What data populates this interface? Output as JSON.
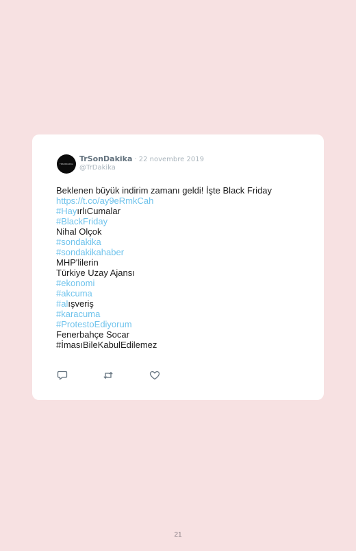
{
  "tweet": {
    "avatar_mark": "TRSONDAKIKA",
    "author_name": "TrSonDakika",
    "separator": "·",
    "date": "22 novembre 2019",
    "handle": "@TrDakika",
    "lines": [
      [
        {
          "t": "Beklenen büyük indirim zamanı geldi! İşte Black Friday",
          "link": false
        }
      ],
      [
        {
          "t": "https://t.co/ay9eRmkCah",
          "link": true
        }
      ],
      [
        {
          "t": "#Hay",
          "link": true
        },
        {
          "t": "ırlıCumalar",
          "link": false
        }
      ],
      [
        {
          "t": "#BlackFriday",
          "link": true
        }
      ],
      [
        {
          "t": "Nihal Olçok",
          "link": false
        }
      ],
      [
        {
          "t": "#sondakika",
          "link": true
        }
      ],
      [
        {
          "t": "#sondakikahaber",
          "link": true
        }
      ],
      [
        {
          "t": "MHP'lilerin",
          "link": false
        }
      ],
      [
        {
          "t": "Türkiye Uzay Ajansı",
          "link": false
        }
      ],
      [
        {
          "t": "#ekonomi",
          "link": true
        }
      ],
      [
        {
          "t": "#akcuma",
          "link": true
        }
      ],
      [
        {
          "t": "#al",
          "link": true
        },
        {
          "t": "ışveriş",
          "link": false
        }
      ],
      [
        {
          "t": "#karacuma",
          "link": true
        }
      ],
      [
        {
          "t": "#ProtestoEdiyorum",
          "link": true
        }
      ],
      [
        {
          "t": "Fenerbahçe Socar",
          "link": false
        }
      ],
      [
        {
          "t": "#İmasıBileKabulEdilemez",
          "link": false
        }
      ]
    ],
    "actions": [
      {
        "icon": "reply-icon"
      },
      {
        "icon": "retweet-icon"
      },
      {
        "icon": "like-icon"
      }
    ]
  },
  "footer": {
    "page_number": "21"
  },
  "colors": {
    "page_background": "#f7e1e2",
    "card_background": "#ffffff",
    "link": "#6fc3ec",
    "text": "#1c1c1c",
    "muted": "#aab5bd",
    "icon": "#62717d"
  }
}
